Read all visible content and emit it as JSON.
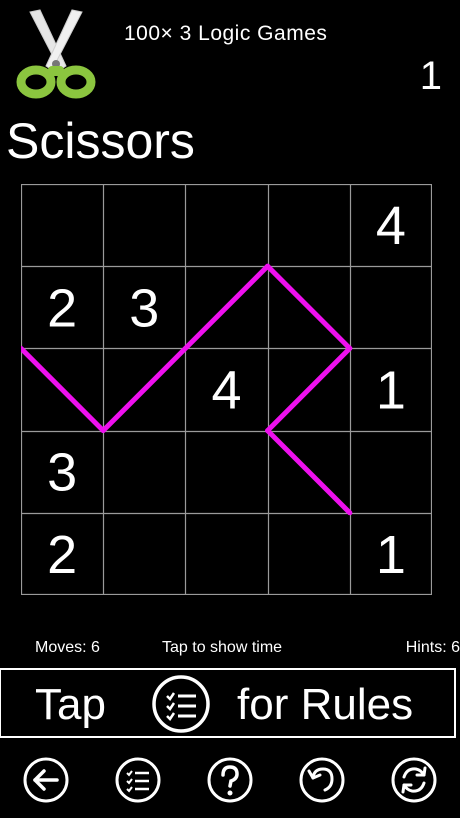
{
  "header": {
    "app_title": "100× 3 Logic Games",
    "level": "1",
    "puzzle_title": "Scissors"
  },
  "board": {
    "rows": 5,
    "cols": 5,
    "cells": [
      [
        "",
        "",
        "",
        "",
        "4"
      ],
      [
        "2",
        "3",
        "",
        "",
        ""
      ],
      [
        "",
        "",
        "4",
        "",
        "1"
      ],
      [
        "3",
        "",
        "",
        "",
        ""
      ],
      [
        "2",
        "",
        "",
        "",
        "1"
      ]
    ],
    "line_color": "#ee10ee",
    "grid_color": "#9a9a9a",
    "segments": [
      [
        [
          0,
          2
        ],
        [
          1,
          3
        ]
      ],
      [
        [
          1,
          3
        ],
        [
          2,
          2
        ]
      ],
      [
        [
          2,
          2
        ],
        [
          3,
          1
        ]
      ],
      [
        [
          3,
          1
        ],
        [
          4,
          2
        ]
      ],
      [
        [
          4,
          2
        ],
        [
          3,
          3
        ]
      ],
      [
        [
          3,
          3
        ],
        [
          4,
          4
        ]
      ]
    ]
  },
  "status": {
    "moves": "Moves: 6",
    "tap_time": "Tap to show time",
    "hints": "Hints: 6"
  },
  "rules_banner": {
    "left": "Tap",
    "right": "for Rules",
    "icon": "list-checks-icon"
  },
  "toolbar": {
    "buttons": [
      {
        "name": "back",
        "icon": "arrow-left-icon"
      },
      {
        "name": "rules",
        "icon": "list-checks-icon"
      },
      {
        "name": "help",
        "icon": "question-icon"
      },
      {
        "name": "undo",
        "icon": "undo-icon"
      },
      {
        "name": "restart",
        "icon": "refresh-icon"
      }
    ]
  },
  "colors": {
    "logo_blade": "#e6e6e6",
    "logo_handle": "#8bc53f"
  }
}
